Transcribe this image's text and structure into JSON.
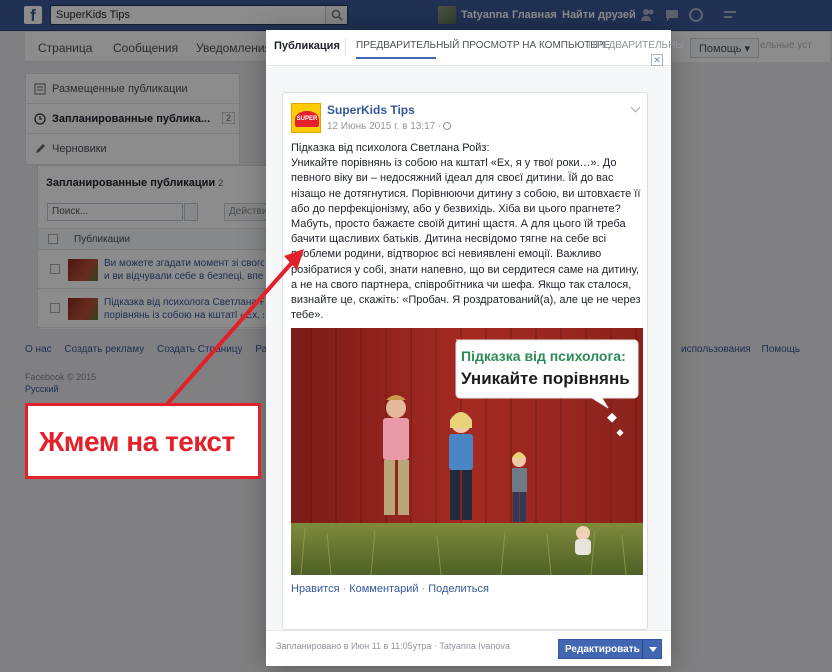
{
  "topbar": {
    "search_value": "SuperKids Tips",
    "user_name": "Tatyanna",
    "home_label": "Главная",
    "find_friends_label": "Найти друзей"
  },
  "page_nav": {
    "tabs": [
      "Страница",
      "Сообщения",
      "Уведомления"
    ],
    "help_label": "Помощь",
    "faded_right": "ельные уст"
  },
  "sidebar": {
    "items": [
      {
        "label": "Размещенные публикации",
        "icon": "posts-icon"
      },
      {
        "label": "Запланированные публика...",
        "icon": "clock-icon",
        "count": "2"
      },
      {
        "label": "Черновики",
        "icon": "pencil-icon"
      }
    ]
  },
  "scheduled": {
    "title": "Запланированные публикации",
    "count": "2",
    "search_placeholder": "Поиск...",
    "actions_label": "Действия",
    "column_header": "Публикации",
    "rows": [
      {
        "line1": "Ви можете згадати момент зі свого ди",
        "line2": "и ви відчували себе в безпеці, впевн"
      },
      {
        "line1": "Підказка від психолога Светлана Ройз",
        "line2": "порівнянь із собою на кштатl «Ех, я у"
      }
    ]
  },
  "footer": {
    "links": [
      "О нас",
      "Создать рекламу",
      "Создать Страницу",
      "Разр"
    ],
    "right_links": [
      "использования",
      "Помощь"
    ],
    "copyright": "Facebook © 2015",
    "language": "Русский"
  },
  "modal": {
    "tab_publication": "Публикация",
    "tab_preview_desktop": "ПРЕДВАРИТЕЛЬНЫЙ ПРОСМОТР НА КОМПЬЮТЕРЕ",
    "tab_preview_short": "ПРЕДВАРИТЕЛЬНЫ",
    "close_label": "✕",
    "post": {
      "page_name": "SuperKids Tips",
      "avatar_text": "SUPER KIDS",
      "date": "12 Июнь 2015 г. в 13:17 ·",
      "text_lines": [
        "Підказка від психолога Светлана Ройз:",
        "Уникайте порівнянь із собою на кштатl «Ех, я у твої роки…». До певного віку ви – недосяжний ідеал для своєї дитини. Їй до вас нізащо не дотягнутися. Порівнюючи дитину з собою, ви штовхаєте її або до перфекціонізму, або у безвихідь. Хіба ви цього прагнете? Мабуть, просто бажаєте своїй дитині щастя. А для цього їй треба бачити щасливих батьків. Дитина несвідомо тягне на себе всі проблеми родини, відтворює всі невиявлені емоції. Важливо розібратися у собі, знати напевно, що ви сердитеся саме на дитину, а не на свого партнера, співробітника чи шефа. Якщо так сталося, визнайте це, скажіть: «Пробач. Я роздратований(а), але це не через тебе»."
      ],
      "image_bubble_title": "Підказка від психолога:",
      "image_bubble_text": "Уникайте порівнянь",
      "action_like": "Нравится",
      "action_comment": "Комментарий",
      "action_share": "Поделиться",
      "separator": "·"
    },
    "footer": {
      "schedule_info": "Запланировано в Июн 11 в 11:05утра · Tatyanna Ivanova",
      "edit_label": "Редактировать"
    }
  },
  "annotation": {
    "text": "Жмем на текст",
    "color": "#e2212a"
  },
  "colors": {
    "facebook_blue": "#3b5998",
    "link_blue": "#365899",
    "button_blue": "#4267b2"
  }
}
